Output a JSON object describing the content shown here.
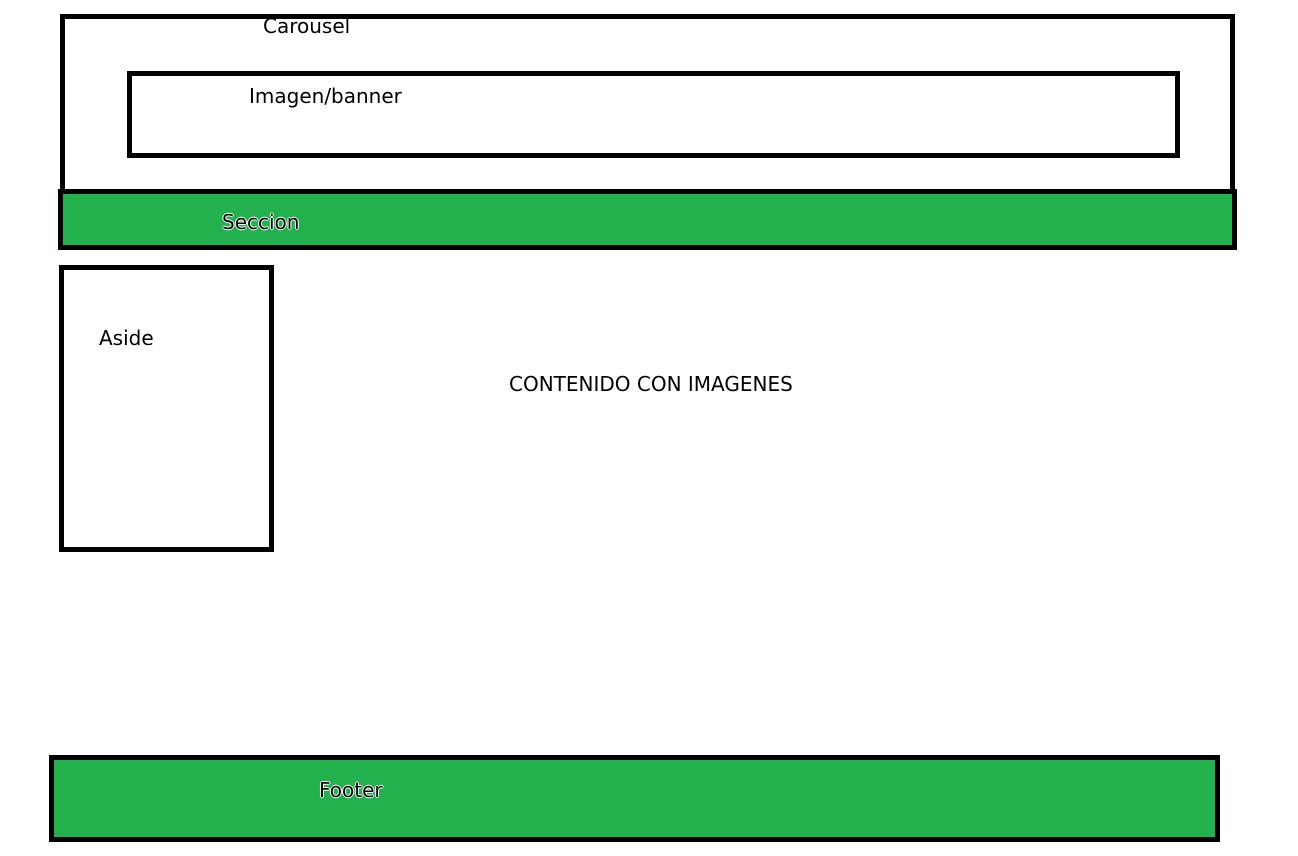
{
  "colors": {
    "section_fill": "#22b14c",
    "footer_fill": "#22b14c",
    "border": "#000000",
    "background": "#ffffff"
  },
  "carousel": {
    "label": "Carousel"
  },
  "banner": {
    "label": "Imagen/banner"
  },
  "seccion": {
    "label": "Seccion"
  },
  "aside": {
    "label": "Aside"
  },
  "content": {
    "label": "CONTENIDO CON IMAGENES"
  },
  "footer": {
    "label": "Footer"
  }
}
